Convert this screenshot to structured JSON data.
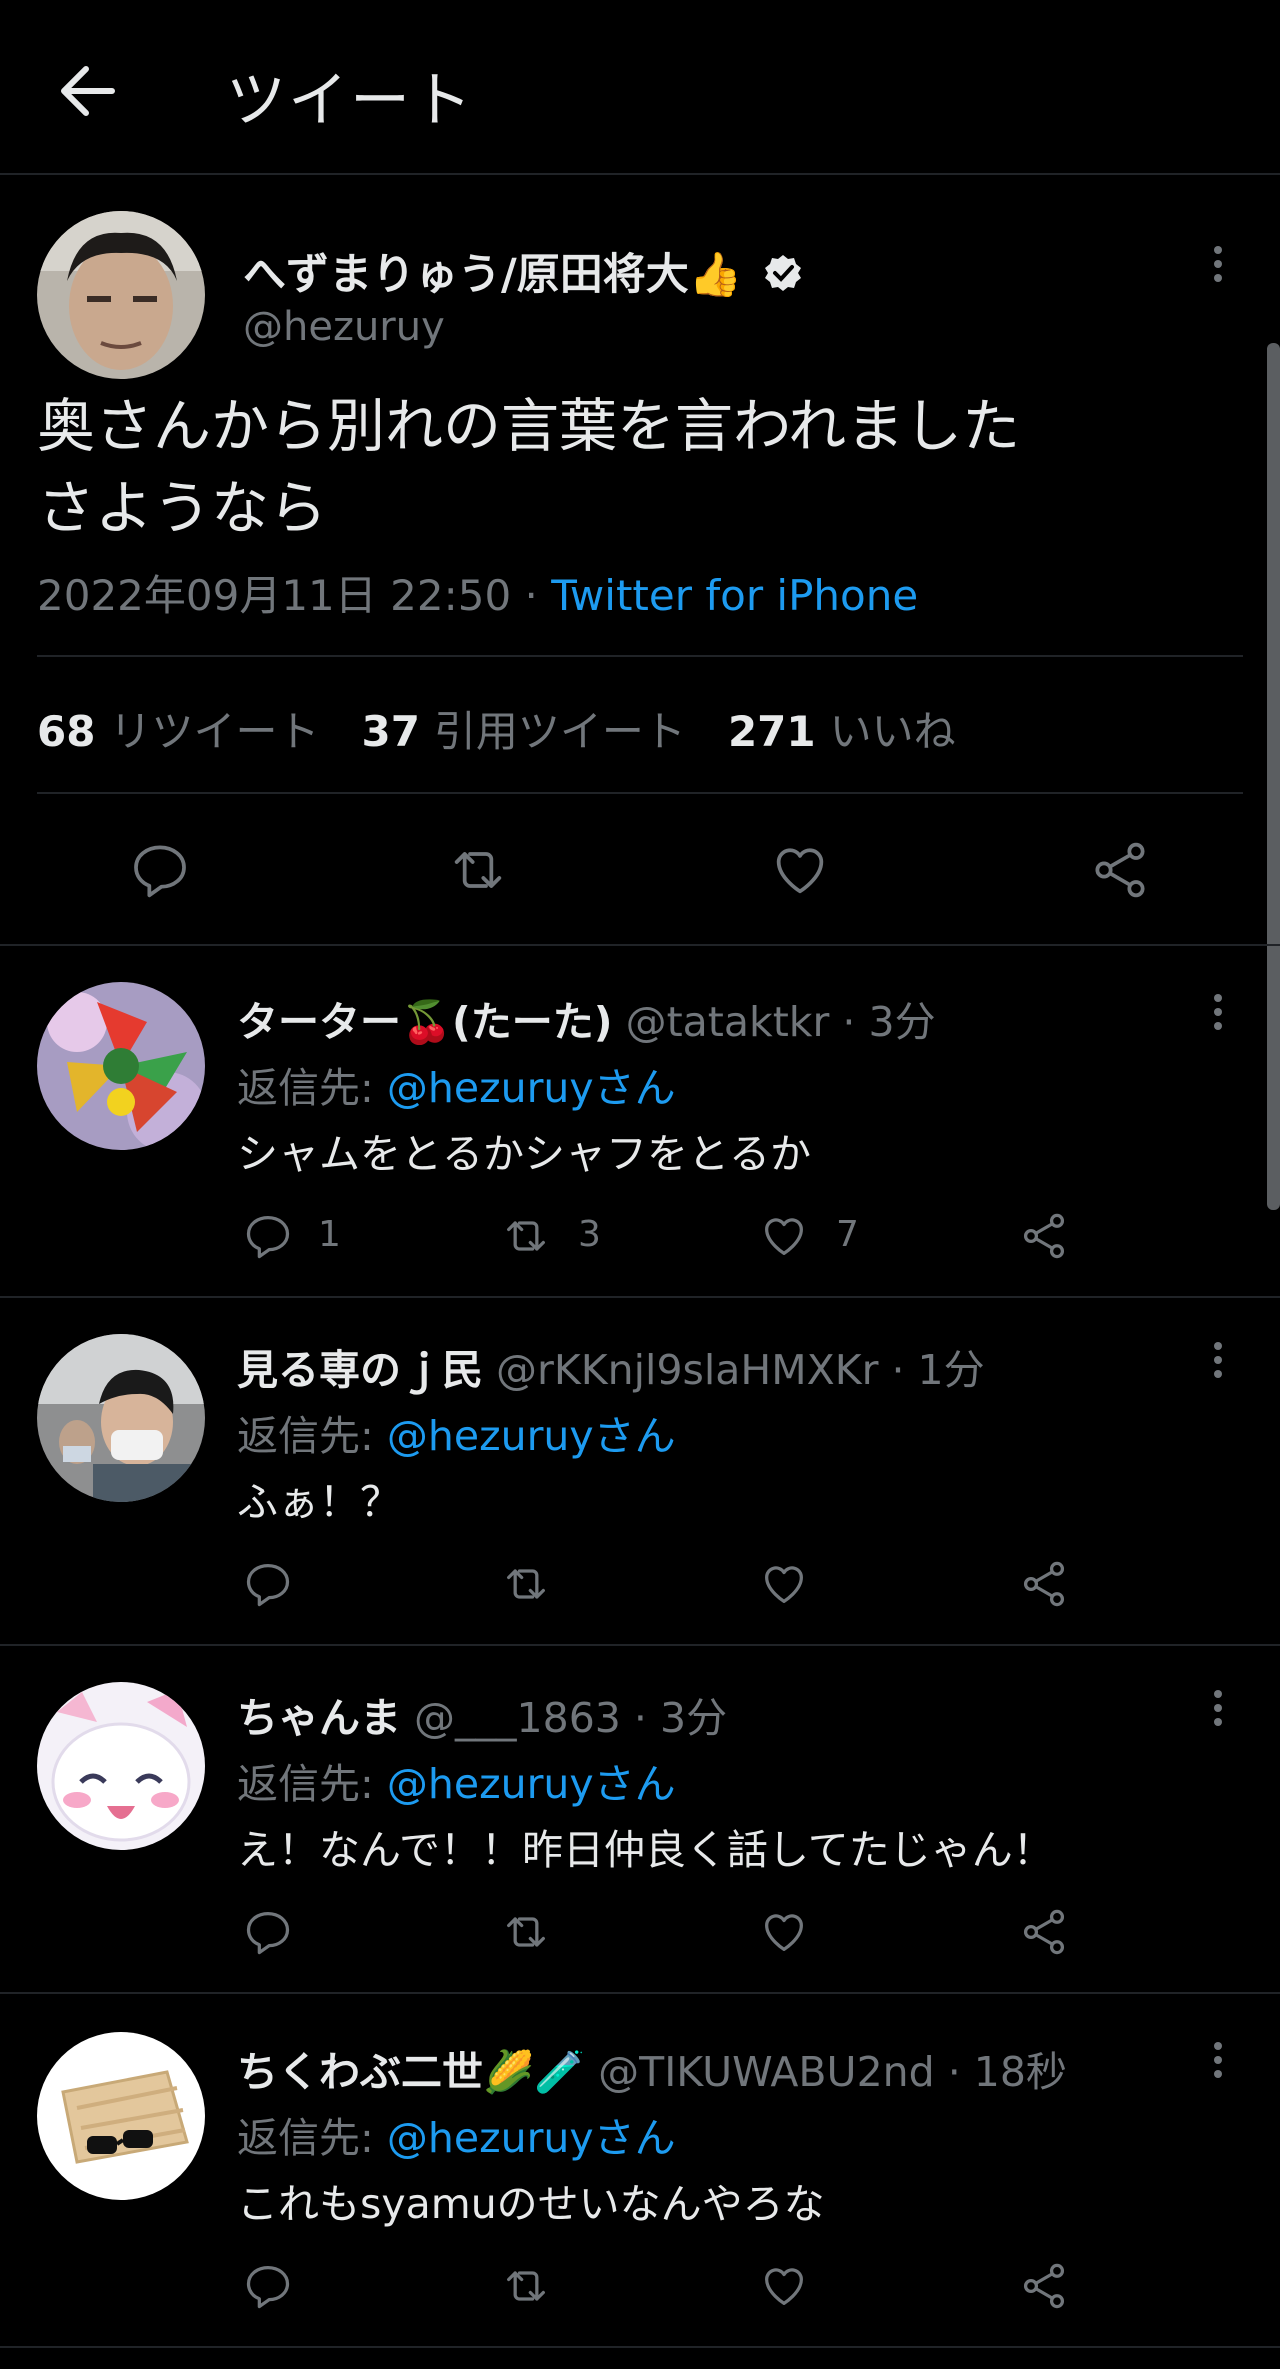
{
  "header": {
    "title": "ツイート",
    "back_icon": "arrow-left-icon"
  },
  "main_tweet": {
    "display_name": "へずまりゅう/原田将大👍",
    "handle": "@hezuruy",
    "text_line1": "奥さんから別れの言葉を言われました",
    "text_line2": "さようなら",
    "date": "2022年09月11日 22:50 · ",
    "client": "Twitter for iPhone",
    "stats": {
      "retweets_count": "68",
      "retweets_label": "リツイート",
      "quotes_count": "37",
      "quotes_label": "引用ツイート",
      "likes_count": "271",
      "likes_label": "いいね"
    }
  },
  "replies": [
    {
      "name": "ターター🍒(たーた)",
      "handle": "@tataktkr · 3分",
      "reply_prefix": "返信先: ",
      "reply_to": "@hezuruyさん",
      "text": "シャムをとるかシャフをとるか",
      "reply_count": "1",
      "retweet_count": "3",
      "like_count": "7"
    },
    {
      "name": "見る専のｊ民",
      "handle": "@rKKnjl9slaHMXKr · 1分",
      "reply_prefix": "返信先: ",
      "reply_to": "@hezuruyさん",
      "text": "ふぁ！？",
      "reply_count": "",
      "retweet_count": "",
      "like_count": ""
    },
    {
      "name": "ちゃんま",
      "handle": "@___1863 · 3分",
      "reply_prefix": "返信先: ",
      "reply_to": "@hezuruyさん",
      "text": "え！なんで！！昨日仲良く話してたじゃん！",
      "reply_count": "",
      "retweet_count": "",
      "like_count": ""
    },
    {
      "name": "ちくわぶ二世🌽🧪",
      "handle": "@TIKUWABU2nd · 18秒",
      "reply_prefix": "返信先: ",
      "reply_to": "@hezuruyさん",
      "text": "これもsyamuのせいなんやろな",
      "reply_count": "",
      "retweet_count": "",
      "like_count": ""
    }
  ],
  "colors": {
    "background": "#000000",
    "text": "#e7e9ea",
    "secondary": "#71767b",
    "accent": "#1d9bf0",
    "divider": "#202327"
  }
}
